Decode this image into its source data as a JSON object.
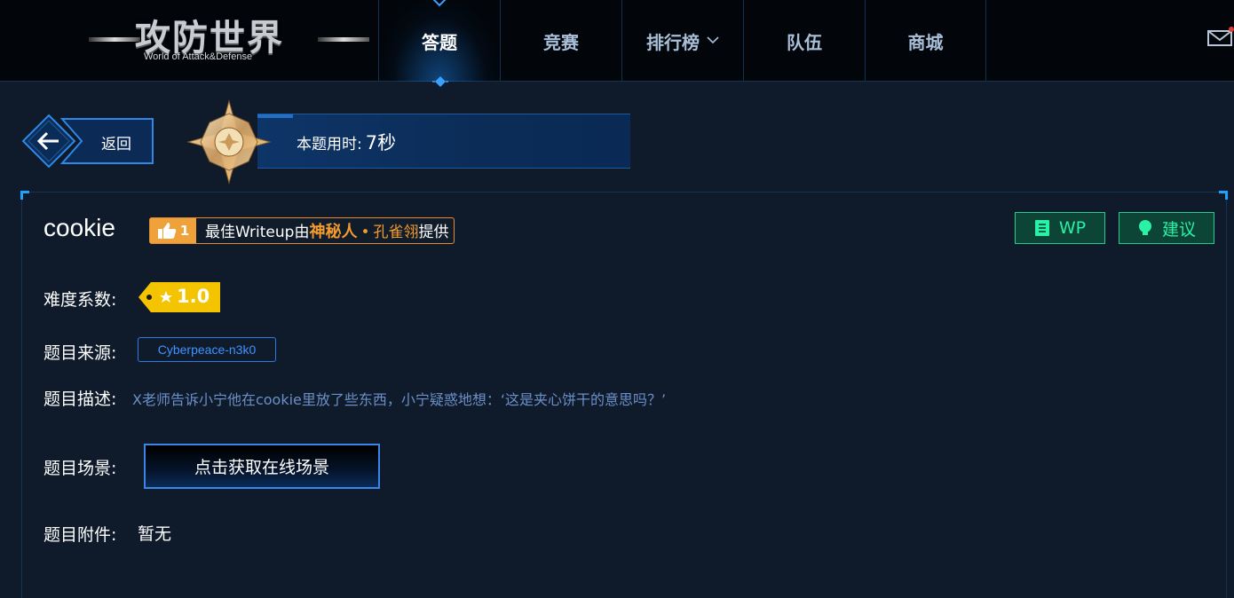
{
  "logo": {
    "title": "攻防世界",
    "subtitle": "World of Attack&Defense"
  },
  "nav": {
    "items": [
      {
        "label": "答题",
        "active": true
      },
      {
        "label": "竞赛",
        "active": false
      },
      {
        "label": "排行榜",
        "active": false,
        "dropdown": true
      },
      {
        "label": "队伍",
        "active": false
      },
      {
        "label": "商城",
        "active": false
      }
    ],
    "mail_icon": "mail-icon"
  },
  "back": {
    "label": "返回",
    "icon": "arrow-left-icon"
  },
  "timer": {
    "label": "本题用时:",
    "value": "7秒"
  },
  "challenge": {
    "title": "cookie",
    "writeup_badge": {
      "likes": "1",
      "prefix": "最佳Writeup由",
      "author": "神秘人",
      "separator": "•",
      "user": "孔雀翎",
      "suffix": "提供"
    },
    "wp_button": "WP",
    "suggest_button": "建议",
    "difficulty_label": "难度系数:",
    "difficulty_value": "1.0",
    "source_label": "题目来源:",
    "source_value": "Cyberpeace-n3k0",
    "description_label": "题目描述:",
    "description": "X老师告诉小宁他在cookie里放了些东西，小宁疑惑地想：‘这是夹心饼干的意思吗？’",
    "scene_label": "题目场景:",
    "scene_button": "点击获取在线场景",
    "attachment_label": "题目附件:",
    "attachment_value": "暂无"
  },
  "colors": {
    "background": "#0f1a2a",
    "accent_blue": "#3a86e8",
    "accent_orange": "#f59a2e",
    "accent_green": "#28f2a5",
    "difficulty_yellow": "#f5c400"
  }
}
